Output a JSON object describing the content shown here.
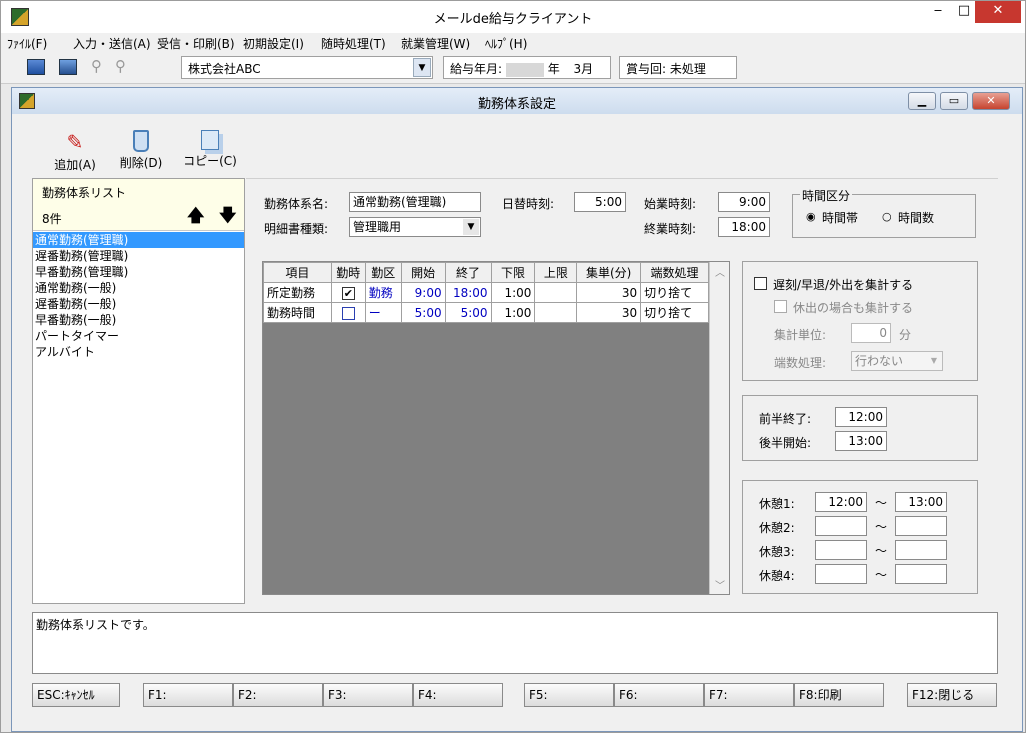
{
  "window": {
    "title": "メールde給与クライアント"
  },
  "menu": [
    "ﾌｧｲﾙ(F)",
    "入力・送信(A)",
    "受信・印刷(B)",
    "初期設定(I)",
    "随時処理(T)",
    "就業管理(W)",
    "ﾍﾙﾌﾟ(H)"
  ],
  "toolbar": {
    "company": "株式会社ABC",
    "pay_month_label": "給与年月:",
    "pay_month_year": "年",
    "pay_month_month": "3月",
    "bonus_label": "賞与回:",
    "bonus_value": "未処理"
  },
  "child": {
    "title": "勤務体系設定"
  },
  "tools": {
    "add": "追加(A)",
    "delete": "削除(D)",
    "copy": "コピー(C)"
  },
  "list": {
    "title": "勤務体系リスト",
    "count": "8件",
    "items": [
      "通常勤務(管理職)",
      "遅番勤務(管理職)",
      "早番勤務(管理職)",
      "通常勤務(一般)",
      "遅番勤務(一般)",
      "早番勤務(一般)",
      "パートタイマー",
      "アルバイト"
    ]
  },
  "form": {
    "name_label": "勤務体系名:",
    "name_value": "通常勤務(管理職)",
    "payslip_label": "明細書種類:",
    "payslip_value": "管理職用",
    "daychange_label": "日替時刻:",
    "daychange_value": "5:00",
    "start_label": "始業時刻:",
    "start_value": "9:00",
    "end_label": "終業時刻:",
    "end_value": "18:00",
    "timediv_title": "時間区分",
    "timediv_opt1": "時間帯",
    "timediv_opt2": "時間数"
  },
  "table": {
    "headers": [
      "項目",
      "勤時",
      "勤区",
      "開始",
      "終了",
      "下限",
      "上限",
      "集単(分)",
      "端数処理"
    ],
    "rows": [
      {
        "item": "所定勤務",
        "check": "✔",
        "kind": "勤務",
        "start": "9:00",
        "end": "18:00",
        "min": "1:00",
        "max": "",
        "unit": "30",
        "round": "切り捨て"
      },
      {
        "item": "勤務時間",
        "check": "",
        "kind": "ー",
        "start": "5:00",
        "end": "5:00",
        "min": "1:00",
        "max": "",
        "unit": "30",
        "round": "切り捨て"
      }
    ]
  },
  "tally": {
    "main": "遅刻/早退/外出を集計する",
    "holiday": "休出の場合も集計する",
    "unit_label": "集計単位:",
    "unit_value": "0",
    "unit_suffix": "分",
    "round_label": "端数処理:",
    "round_value": "行わない"
  },
  "half": {
    "first_label": "前半終了:",
    "first_value": "12:00",
    "second_label": "後半開始:",
    "second_value": "13:00"
  },
  "breaks": {
    "tilde": "～",
    "rows": [
      {
        "label": "休憩1:",
        "from": "12:00",
        "to": "13:00"
      },
      {
        "label": "休憩2:",
        "from": "",
        "to": ""
      },
      {
        "label": "休憩3:",
        "from": "",
        "to": ""
      },
      {
        "label": "休憩4:",
        "from": "",
        "to": ""
      }
    ]
  },
  "status": {
    "message": "勤務体系リストです。"
  },
  "fkeys": [
    "ESC:ｷｬﾝｾﾙ",
    "F1:",
    "F2:",
    "F3:",
    "F4:",
    "F5:",
    "F6:",
    "F7:",
    "F8:印刷",
    "F12:閉じる"
  ]
}
